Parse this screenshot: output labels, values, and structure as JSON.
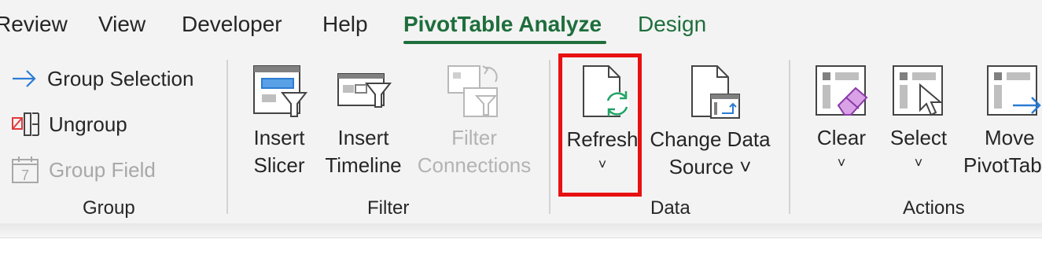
{
  "tabs": [
    {
      "label": "Review"
    },
    {
      "label": "View"
    },
    {
      "label": "Developer"
    },
    {
      "label": "Help"
    },
    {
      "label": "PivotTable Analyze"
    },
    {
      "label": "Design"
    }
  ],
  "groups": {
    "group": {
      "label": "Group",
      "items": [
        {
          "label": "Group Selection",
          "icon": "arrow-right-icon"
        },
        {
          "label": "Ungroup",
          "icon": "ungroup-icon"
        },
        {
          "label": "Group Field",
          "icon": "calendar-icon",
          "disabled": true
        }
      ]
    },
    "filter": {
      "label": "Filter",
      "insert_slicer": {
        "line1": "Insert",
        "line2": "Slicer"
      },
      "insert_timeline": {
        "line1": "Insert",
        "line2": "Timeline"
      },
      "filter_connections": {
        "line1": "Filter",
        "line2": "Connections",
        "disabled": true
      }
    },
    "data": {
      "label": "Data",
      "refresh": {
        "line1": "Refresh",
        "chevron": "˅"
      },
      "change_data_source": {
        "line1": "Change Data",
        "line2": "Source ˅"
      }
    },
    "actions": {
      "label": "Actions",
      "clear": {
        "line1": "Clear",
        "chevron": "˅"
      },
      "select": {
        "line1": "Select",
        "chevron": "˅"
      },
      "move": {
        "line1": "Move",
        "line2": "PivotTab"
      }
    }
  },
  "colors": {
    "accent": "#1e6e3c",
    "highlight": "#e81010",
    "icon_blue": "#2b7cd3",
    "icon_green": "#21a366"
  }
}
